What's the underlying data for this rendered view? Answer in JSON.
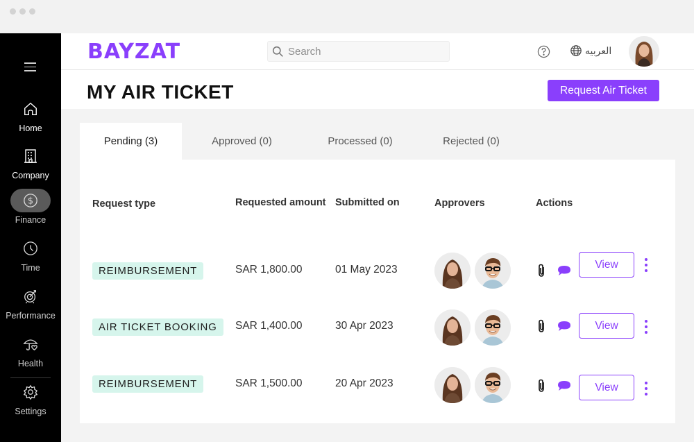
{
  "app": {
    "brand": "BAYZAT",
    "accent_color": "#8a3ffc",
    "tag_color": "#d6f5ec"
  },
  "sidebar": {
    "menu_icon": "hamburger-icon",
    "items": [
      {
        "label": "Home",
        "icon": "home-icon"
      },
      {
        "label": "Company",
        "icon": "building-icon"
      },
      {
        "label": "Finance",
        "icon": "dollar-circle-icon",
        "active": true
      },
      {
        "label": "Time",
        "icon": "clock-icon"
      },
      {
        "label": "Performance",
        "icon": "target-icon"
      },
      {
        "label": "Health",
        "icon": "umbrella-heart-icon"
      },
      {
        "label": "Settings",
        "icon": "gear-icon"
      }
    ]
  },
  "topbar": {
    "search_placeholder": "Search",
    "language_label": "العربيه",
    "help_icon": "help-icon",
    "globe_icon": "globe-icon"
  },
  "header": {
    "title": "MY AIR TICKET",
    "request_button": "Request Air Ticket"
  },
  "tabs": [
    {
      "label": "Pending (3)",
      "active": true
    },
    {
      "label": "Approved (0)"
    },
    {
      "label": "Processed (0)"
    },
    {
      "label": "Rejected (0)"
    }
  ],
  "table": {
    "columns": [
      "Request type",
      "Requested amount",
      "Submitted on",
      "Approvers",
      "Actions"
    ],
    "rows": [
      {
        "type": "REIMBURSEMENT",
        "amount": "SAR 1,800.00",
        "submitted": "01 May 2023",
        "approvers": [
          "approver-female",
          "approver-male"
        ],
        "view_label": "View"
      },
      {
        "type": "AIR TICKET BOOKING",
        "amount": "SAR 1,400.00",
        "submitted": "30 Apr 2023",
        "approvers": [
          "approver-female",
          "approver-male"
        ],
        "view_label": "View"
      },
      {
        "type": "REIMBURSEMENT",
        "amount": "SAR 1,500.00",
        "submitted": "20 Apr 2023",
        "approvers": [
          "approver-female",
          "approver-male"
        ],
        "view_label": "View"
      }
    ]
  }
}
